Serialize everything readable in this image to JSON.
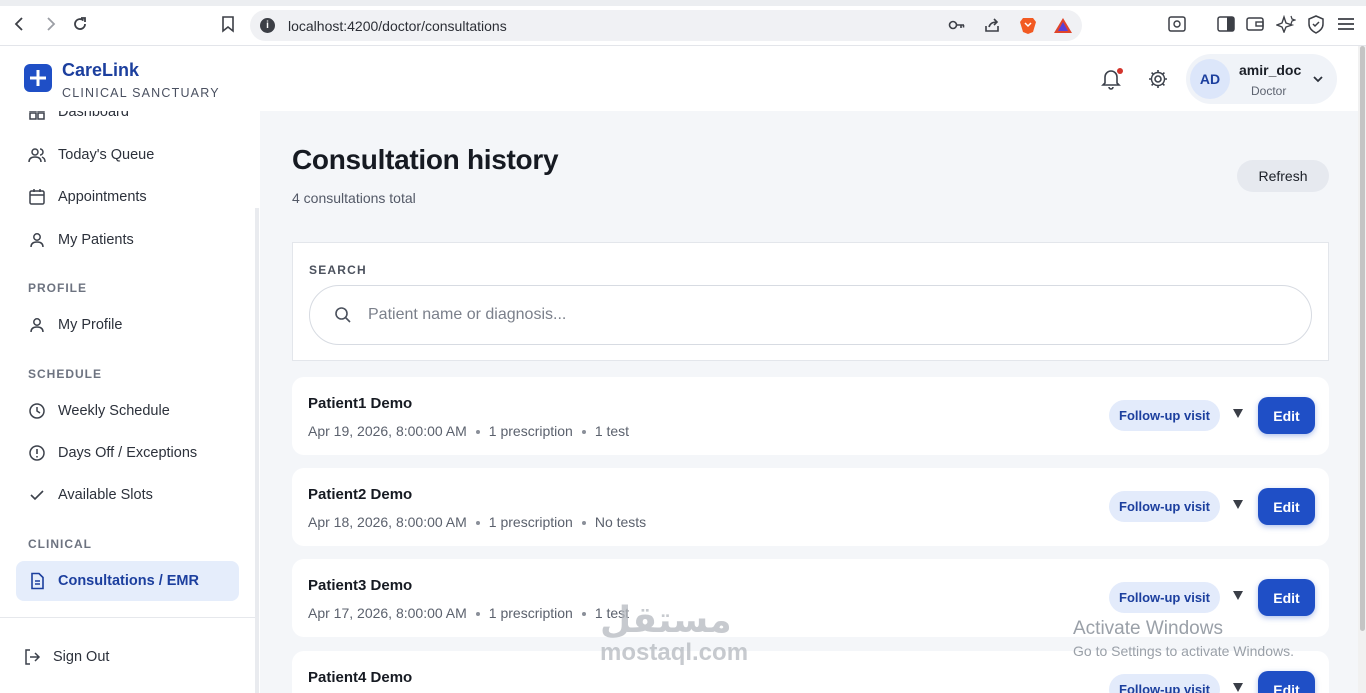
{
  "browser": {
    "url": "localhost:4200/doctor/consultations"
  },
  "brand": {
    "name": "CareLink",
    "subtitle": "CLINICAL SANCTUARY",
    "accent": "#1f4fc6"
  },
  "user": {
    "initials": "AD",
    "name": "amir_doc",
    "role": "Doctor"
  },
  "sidebar": {
    "items_top": [
      {
        "label": "Dashboard",
        "icon": "grid-icon"
      },
      {
        "label": "Today's Queue",
        "icon": "users-icon"
      },
      {
        "label": "Appointments",
        "icon": "calendar-icon"
      },
      {
        "label": "My Patients",
        "icon": "user-icon"
      }
    ],
    "sections": [
      {
        "title": "PROFILE",
        "items": [
          {
            "label": "My Profile",
            "icon": "user-icon"
          }
        ]
      },
      {
        "title": "SCHEDULE",
        "items": [
          {
            "label": "Weekly Schedule",
            "icon": "clock-icon"
          },
          {
            "label": "Days Off / Exceptions",
            "icon": "alert-circle-icon"
          },
          {
            "label": "Available Slots",
            "icon": "check-icon"
          }
        ]
      },
      {
        "title": "CLINICAL",
        "items": [
          {
            "label": "Consultations / EMR",
            "icon": "document-icon",
            "active": true
          }
        ]
      }
    ],
    "sign_out": "Sign Out"
  },
  "main": {
    "title": "Consultation history",
    "subtitle": "4 consultations total",
    "refresh_label": "Refresh",
    "search": {
      "label": "SEARCH",
      "placeholder": "Patient name or diagnosis..."
    },
    "consultations": [
      {
        "patient": "Patient1 Demo",
        "date": "Apr 19, 2026, 8:00:00 AM",
        "prescriptions": "1 prescription",
        "tests": "1 test",
        "type": "Follow-up visit",
        "action": "Edit"
      },
      {
        "patient": "Patient2 Demo",
        "date": "Apr 18, 2026, 8:00:00 AM",
        "prescriptions": "1 prescription",
        "tests": "No tests",
        "type": "Follow-up visit",
        "action": "Edit"
      },
      {
        "patient": "Patient3 Demo",
        "date": "Apr 17, 2026, 8:00:00 AM",
        "prescriptions": "1 prescription",
        "tests": "1 test",
        "type": "Follow-up visit",
        "action": "Edit"
      },
      {
        "patient": "Patient4 Demo",
        "date": "",
        "prescriptions": "",
        "tests": "",
        "type": "Follow-up visit",
        "action": "Edit"
      }
    ]
  },
  "watermarks": {
    "windows_title": "Activate Windows",
    "windows_sub": "Go to Settings to activate Windows.",
    "mostaql_ar": "مستقل",
    "mostaql_en": "mostaql.com"
  }
}
